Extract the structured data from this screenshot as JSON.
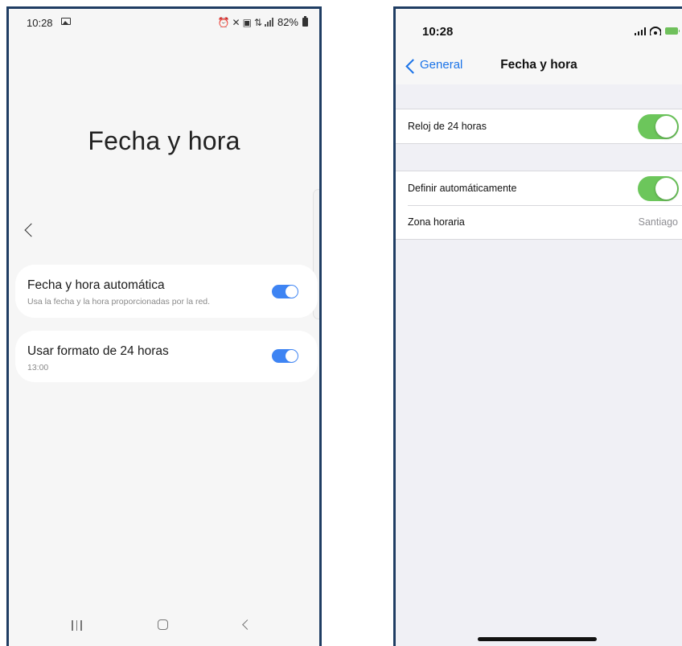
{
  "android": {
    "status": {
      "time": "10:28",
      "battery_text": "82%"
    },
    "title": "Fecha y hora",
    "settings": [
      {
        "label": "Fecha y hora automática",
        "sub": "Usa la fecha y la hora proporcionadas por la red.",
        "enabled": true
      },
      {
        "label": "Usar formato de 24 horas",
        "sub": "13:00",
        "enabled": true
      }
    ],
    "accent_color": "#3e84f3"
  },
  "ios": {
    "status": {
      "time": "10:28"
    },
    "nav": {
      "back_label": "General",
      "title": "Fecha y hora"
    },
    "groups": [
      {
        "rows": [
          {
            "label": "Reloj de 24 horas",
            "type": "toggle",
            "enabled": true
          }
        ]
      },
      {
        "rows": [
          {
            "label": "Definir automáticamente",
            "type": "toggle",
            "enabled": true
          },
          {
            "label": "Zona horaria",
            "type": "value",
            "value": "Santiago"
          }
        ]
      }
    ],
    "accent_color": "#1a73e8",
    "toggle_color": "#6cc65b"
  }
}
